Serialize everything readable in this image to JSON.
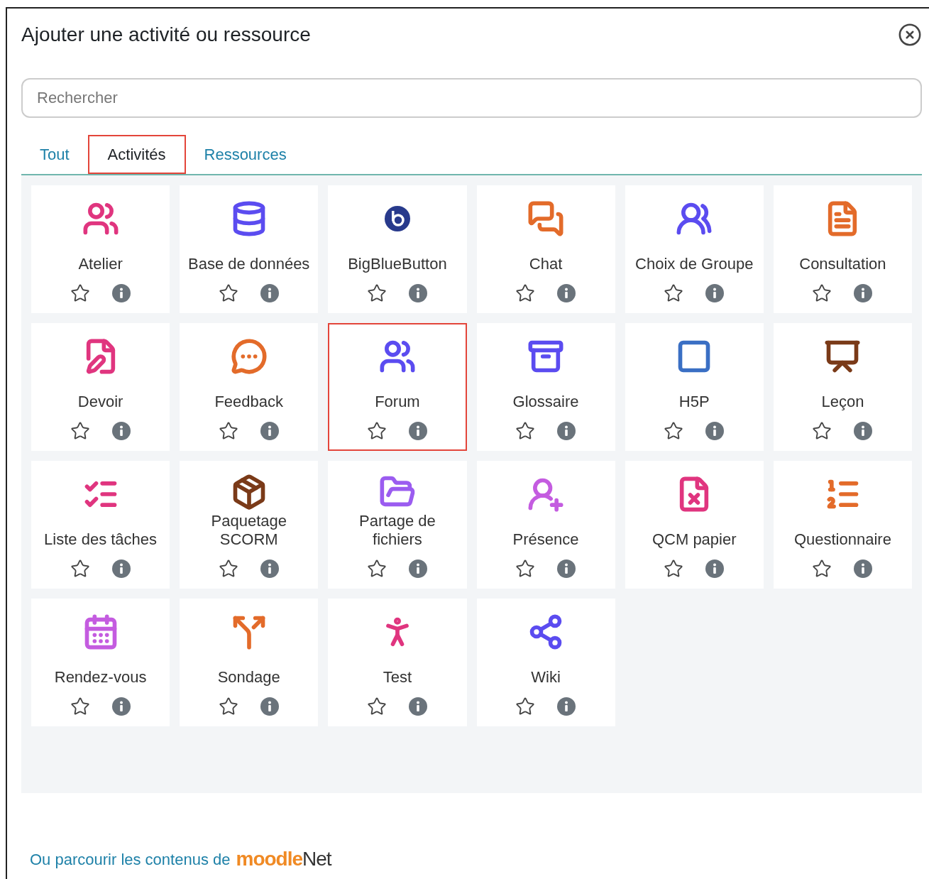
{
  "dialog": {
    "title": "Ajouter une activité ou ressource"
  },
  "search": {
    "placeholder": "Rechercher"
  },
  "tabs": [
    {
      "label": "Tout",
      "selected": false
    },
    {
      "label": "Activités",
      "selected": true
    },
    {
      "label": "Ressources",
      "selected": false
    }
  ],
  "items": [
    {
      "label": "Atelier",
      "color": "#e0357f",
      "highlighted": false
    },
    {
      "label": "Base de données",
      "color": "#5b4cf0",
      "highlighted": false
    },
    {
      "label": "BigBlueButton",
      "color": "#283a8c",
      "highlighted": false
    },
    {
      "label": "Chat",
      "color": "#e36b2a",
      "highlighted": false
    },
    {
      "label": "Choix de Groupe",
      "color": "#5b4cf0",
      "highlighted": false
    },
    {
      "label": "Consultation",
      "color": "#e36b2a",
      "highlighted": false
    },
    {
      "label": "Devoir",
      "color": "#e0357f",
      "highlighted": false
    },
    {
      "label": "Feedback",
      "color": "#e36b2a",
      "highlighted": false
    },
    {
      "label": "Forum",
      "color": "#5b4cf0",
      "highlighted": true
    },
    {
      "label": "Glossaire",
      "color": "#5b4cf0",
      "highlighted": false
    },
    {
      "label": "H5P",
      "color": "#3a6fc4",
      "highlighted": false
    },
    {
      "label": "Leçon",
      "color": "#7a3a18",
      "highlighted": false
    },
    {
      "label": "Liste des tâches",
      "color": "#e0357f",
      "highlighted": false
    },
    {
      "label": "Paquetage SCORM",
      "color": "#7a3a18",
      "highlighted": false
    },
    {
      "label": "Partage de fichiers",
      "color": "#9b5cf0",
      "highlighted": false
    },
    {
      "label": "Présence",
      "color": "#c45ce0",
      "highlighted": false
    },
    {
      "label": "QCM papier",
      "color": "#e0357f",
      "highlighted": false
    },
    {
      "label": "Questionnaire",
      "color": "#e36b2a",
      "highlighted": false
    },
    {
      "label": "Rendez-vous",
      "color": "#c45ce0",
      "highlighted": false
    },
    {
      "label": "Sondage",
      "color": "#e36b2a",
      "highlighted": false
    },
    {
      "label": "Test",
      "color": "#e0357f",
      "highlighted": false
    },
    {
      "label": "Wiki",
      "color": "#5b4cf0",
      "highlighted": false
    }
  ],
  "footer": {
    "text": "Ou parcourir les contenus de",
    "logo_main": "moodle",
    "logo_suffix": "Net"
  }
}
